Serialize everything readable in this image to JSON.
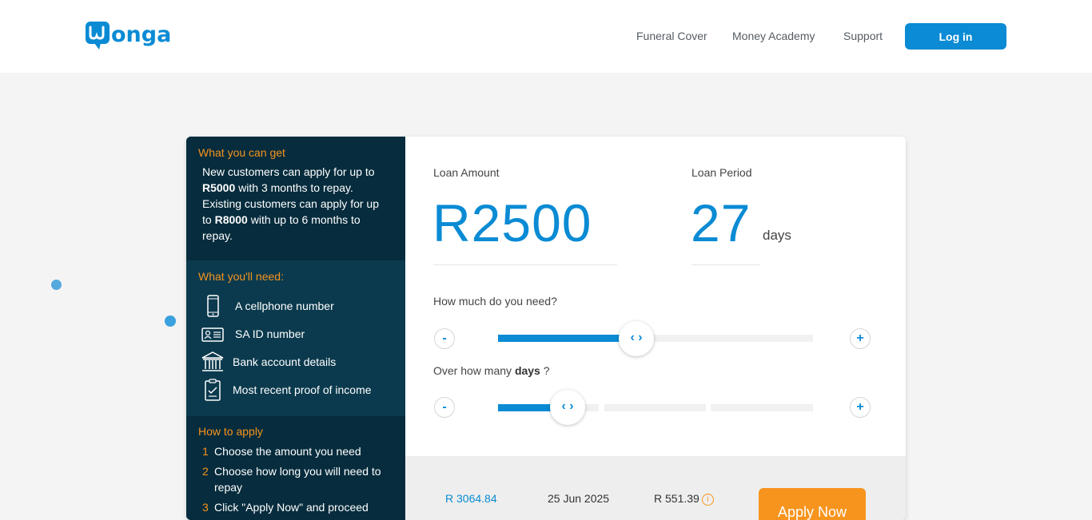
{
  "brand": {
    "name": "wonga",
    "color": "#0a8bd4",
    "accent": "#f7941d"
  },
  "nav": {
    "links": [
      "Funeral Cover",
      "Money Academy",
      "Support"
    ],
    "login": "Log in"
  },
  "sidebar": {
    "get_title": "What you can get",
    "intro": {
      "p1": "New customers can apply for up to ",
      "b1": "R5000",
      "p2": " with 3 months to repay. Existing customers can apply for up to ",
      "b2": "R8000",
      "p3": " with up to 6 months to repay."
    },
    "need_title": "What you'll need:",
    "needs": [
      {
        "icon": "phone-icon",
        "label": "A cellphone number"
      },
      {
        "icon": "id-card-icon",
        "label": "SA ID number"
      },
      {
        "icon": "bank-icon",
        "label": "Bank account details"
      },
      {
        "icon": "document-icon",
        "label": "Most recent proof of income"
      }
    ],
    "apply_title": "How to apply",
    "steps": [
      {
        "num": "1",
        "text": "Choose the amount you need"
      },
      {
        "num": "2",
        "text": "Choose how long you will need to repay"
      },
      {
        "num": "3",
        "text": "Click \"Apply Now\" and proceed"
      }
    ]
  },
  "calculator": {
    "amount_label": "Loan Amount",
    "amount_value": "R2500",
    "period_label": "Loan Period",
    "period_value": "27",
    "period_unit": "days",
    "amount_question": "How much do you need?",
    "days_question_prefix": "Over how many ",
    "days_question_bold": "days",
    "days_question_suffix": " ?",
    "minus": "-",
    "plus": "+",
    "amount_fraction": 0.44,
    "days_fraction": 0.22
  },
  "summary": {
    "total": "R 3064.84",
    "date": "25 Jun 2025",
    "fee": "R 551.39",
    "info": "i",
    "apply": "Apply Now"
  }
}
